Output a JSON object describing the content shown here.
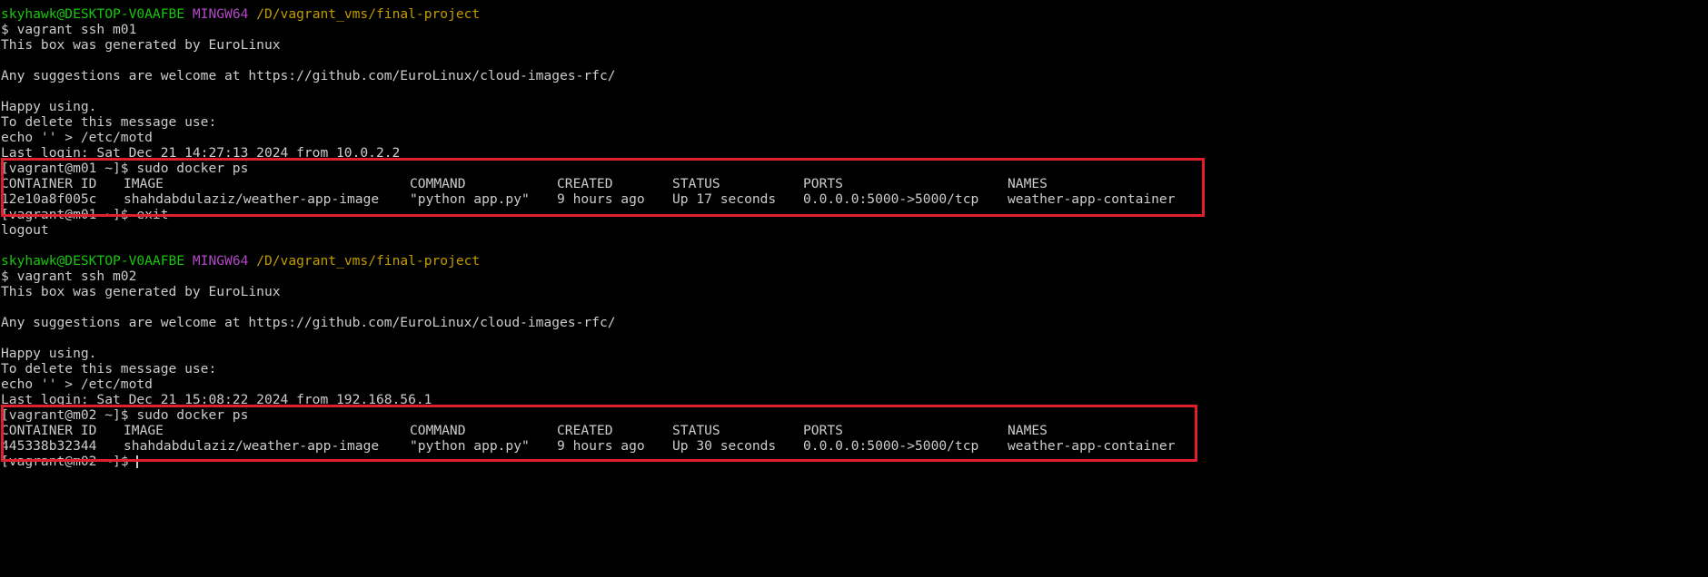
{
  "sessions": [
    {
      "prompt": {
        "user_host": "skyhawk@DESKTOP-V0AAFBE",
        "shell": "MINGW64",
        "path": "/D/vagrant_vms/final-project"
      },
      "command": "$ vagrant ssh m01",
      "motd": {
        "generated_by": "This box was generated by EuroLinux",
        "suggestions": "Any suggestions are welcome at https://github.com/EuroLinux/cloud-images-rfc/",
        "happy": "Happy using.",
        "delete_hint": "To delete this message use:",
        "delete_cmd": "echo '' > /etc/motd",
        "last_login": "Last login: Sat Dec 21 14:27:13 2024 from 10.0.2.2"
      },
      "docker_prompt": "[vagrant@m01 ~]$ sudo docker ps",
      "table_headers": [
        "CONTAINER ID",
        "IMAGE",
        "COMMAND",
        "CREATED",
        "STATUS",
        "PORTS",
        "NAMES"
      ],
      "table_row": [
        "12e10a8f005c",
        "shahdabdulaziz/weather-app-image",
        "\"python app.py\"",
        "9 hours ago",
        "Up 17 seconds",
        "0.0.0.0:5000->5000/tcp",
        "weather-app-container"
      ],
      "after": [
        "[vagrant@m01 ~]$ exit",
        "logout"
      ]
    },
    {
      "prompt": {
        "user_host": "skyhawk@DESKTOP-V0AAFBE",
        "shell": "MINGW64",
        "path": "/D/vagrant_vms/final-project"
      },
      "command": "$ vagrant ssh m02",
      "motd": {
        "generated_by": "This box was generated by EuroLinux",
        "suggestions": "Any suggestions are welcome at https://github.com/EuroLinux/cloud-images-rfc/",
        "happy": "Happy using.",
        "delete_hint": "To delete this message use:",
        "delete_cmd": "echo '' > /etc/motd",
        "last_login": "Last login: Sat Dec 21 15:08:22 2024 from 192.168.56.1"
      },
      "docker_prompt": "[vagrant@m02 ~]$ sudo docker ps",
      "table_headers": [
        "CONTAINER ID",
        "IMAGE",
        "COMMAND",
        "CREATED",
        "STATUS",
        "PORTS",
        "NAMES"
      ],
      "table_row": [
        "445338b32344",
        "shahdabdulaziz/weather-app-image",
        "\"python app.py\"",
        "9 hours ago",
        "Up 30 seconds",
        "0.0.0.0:5000->5000/tcp",
        "weather-app-container"
      ],
      "final_prompt": "[vagrant@m02 ~]$ "
    }
  ],
  "colors": {
    "background": "#000000",
    "text": "#cccccc",
    "user_host": "#16c60c",
    "shell": "#b148c6",
    "path": "#c19c00",
    "highlight_box": "#e0202c"
  }
}
